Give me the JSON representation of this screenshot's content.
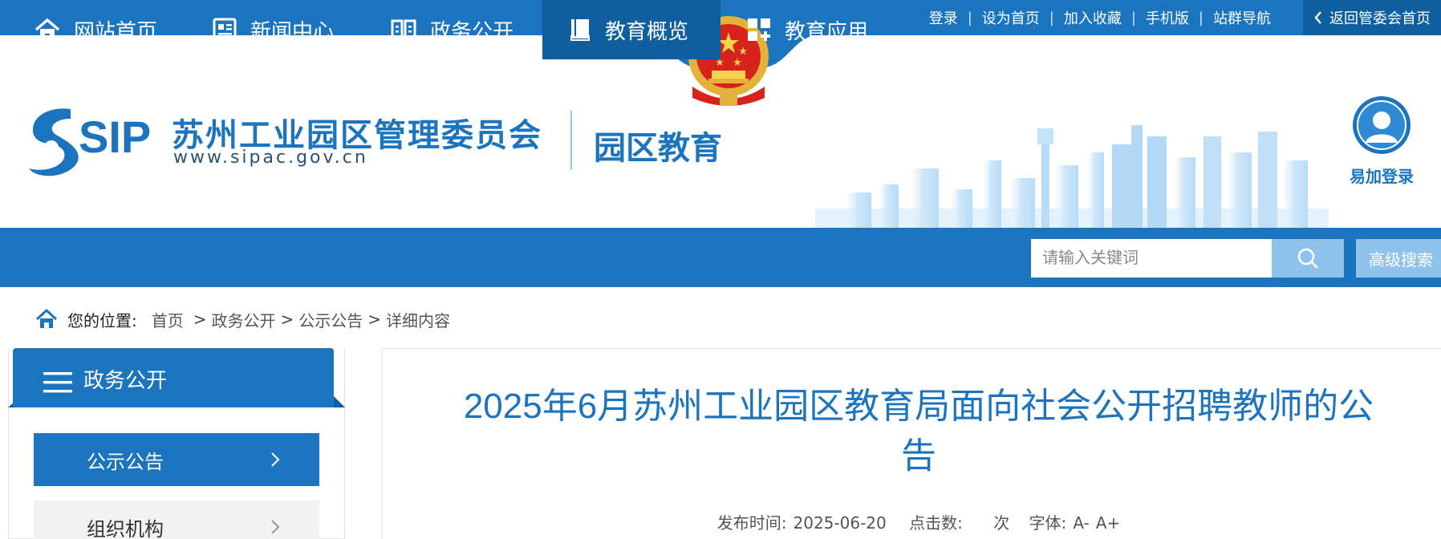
{
  "topbar": {
    "links": [
      "登录",
      "设为首页",
      "加入收藏",
      "手机版",
      "站群导航"
    ],
    "separator": "|",
    "back_home": "返回管委会首页"
  },
  "header": {
    "logo_text": "SIP",
    "org_name": "苏州工业园区管理委员会",
    "org_url": "www.sipac.gov.cn",
    "site_name": "园区教育",
    "login_label": "易加登录"
  },
  "nav": {
    "items": [
      {
        "label": "网站首页",
        "icon": "home-icon"
      },
      {
        "label": "新闻中心",
        "icon": "news-icon"
      },
      {
        "label": "政务公开",
        "icon": "book-open-icon"
      },
      {
        "label": "教育概览",
        "icon": "book-icon"
      },
      {
        "label": "教育应用",
        "icon": "apps-icon"
      }
    ],
    "active_index": 3,
    "search_placeholder": "请输入关键词",
    "advanced_search": "高级搜索"
  },
  "breadcrumb": {
    "label": "您的位置:",
    "items": [
      "首页",
      "政务公开",
      "公示公告",
      "详细内容"
    ],
    "separator": ">"
  },
  "sidebar": {
    "title": "政务公开",
    "items": [
      {
        "label": "公示公告",
        "active": true
      },
      {
        "label": "组织机构",
        "active": false
      }
    ]
  },
  "article": {
    "title": "2025年6月苏州工业园区教育局面向社会公开招聘教师的公告",
    "publish_label": "发布时间:",
    "publish_date": "2025-06-20",
    "clicks_label": "点击数:",
    "clicks_unit": "次",
    "font_label": "字体:",
    "font_smaller": "A-",
    "font_larger": "A+"
  },
  "colors": {
    "primary": "#1b74bd",
    "dark": "#0f5f9f",
    "light": "#8fc3ee"
  }
}
